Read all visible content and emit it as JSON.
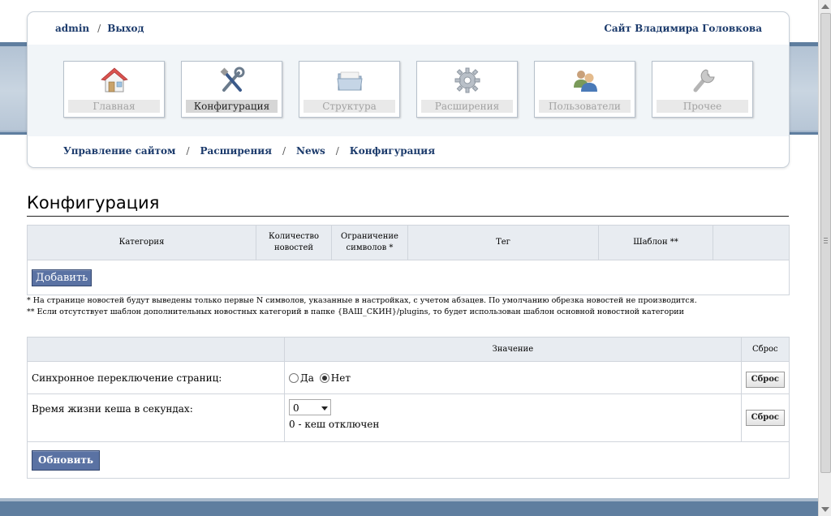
{
  "header": {
    "user": "admin",
    "separator": "/",
    "logout": "Выход",
    "site_name": "Сайт Владимира Головкова"
  },
  "nav": [
    {
      "label": "Главная",
      "icon": "home-icon",
      "active": false
    },
    {
      "label": "Конфигурация",
      "icon": "tools-icon",
      "active": true
    },
    {
      "label": "Структура",
      "icon": "folder-icon",
      "active": false
    },
    {
      "label": "Расширения",
      "icon": "gear-icon",
      "active": false
    },
    {
      "label": "Пользователи",
      "icon": "users-icon",
      "active": false
    },
    {
      "label": "Прочее",
      "icon": "wrench-icon",
      "active": false
    }
  ],
  "breadcrumb": [
    "Управление сайтом",
    "Расширения",
    "News",
    "Конфигурация"
  ],
  "page_title": "Конфигурация",
  "categories_table": {
    "headers": [
      "Категория",
      "Количество новостей",
      "Ограничение символов *",
      "Тег",
      "Шаблон **",
      ""
    ],
    "add_button": "Добавить"
  },
  "notes": [
    "* На странице новостей будут выведены только первые N символов, указанные в настройках, с учетом абзацев. По умолчанию обрезка новостей не производится.",
    "** Если отсутствует шаблон дополнительных новостных категорий в папке {ВАШ_СКИН}/plugins, то будет использован шаблон основной новостной категории"
  ],
  "settings_table": {
    "headers": [
      "",
      "Значение",
      "Сброс"
    ],
    "rows": [
      {
        "label": "Синхронное переключение страниц:",
        "radio_yes": "Да",
        "radio_no": "Нет",
        "selected": "Нет",
        "reset_label": "Сброс"
      },
      {
        "label": "Время жизни кеша в секундах:",
        "select_value": "0",
        "hint": "0 - кеш отключен",
        "reset_label": "Сброс"
      }
    ],
    "update_button": "Обновить"
  },
  "colors": {
    "link": "#1b3a6b",
    "button_blue": "#5a72a3",
    "band_blue": "#5f7e9f"
  }
}
